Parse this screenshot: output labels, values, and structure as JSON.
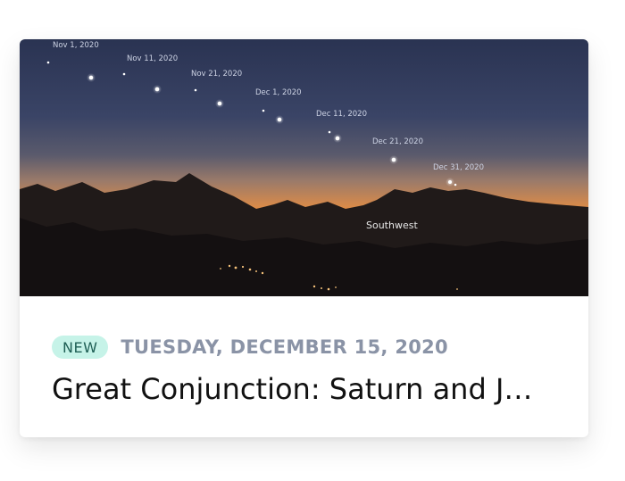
{
  "hero": {
    "sky_labels": [
      "Nov 1, 2020",
      "Nov 11, 2020",
      "Nov 21, 2020",
      "Dec 1, 2020",
      "Dec 11, 2020",
      "Dec 21, 2020",
      "Dec 31, 2020"
    ],
    "direction_label": "Southwest"
  },
  "card": {
    "badge": "NEW",
    "date": "TUESDAY, DECEMBER 15, 2020",
    "title": "Great Conjunction: Saturn and J…"
  },
  "colors": {
    "badge_bg": "#c6f3e8",
    "badge_text": "#1f5f55",
    "date_text": "#8a93a6",
    "title_text": "#111111",
    "sky_top": "#2a3352",
    "sky_horizon": "#f0902a",
    "mountains": "#1a1514"
  }
}
